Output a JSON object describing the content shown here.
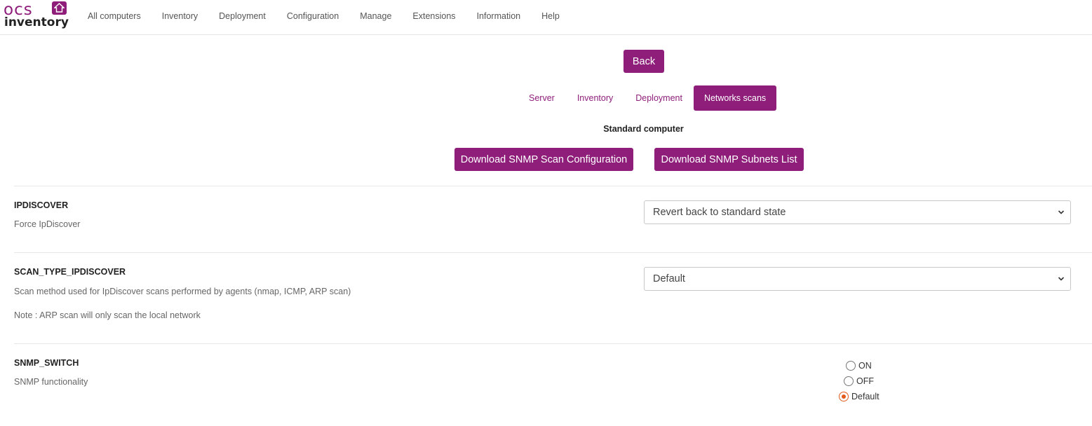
{
  "brand": {
    "logo_top": "ocs",
    "logo_bottom": "inventory",
    "color": "#8e1e7a"
  },
  "nav": {
    "items": [
      "All computers",
      "Inventory",
      "Deployment",
      "Configuration",
      "Manage",
      "Extensions",
      "Information",
      "Help"
    ]
  },
  "back_label": "Back",
  "tabs": [
    {
      "label": "Server",
      "active": false
    },
    {
      "label": "Inventory",
      "active": false
    },
    {
      "label": "Deployment",
      "active": false
    },
    {
      "label": "Networks scans",
      "active": true
    }
  ],
  "subtitle": "Standard computer",
  "downloads": {
    "scan_config": "Download SNMP Scan Configuration",
    "subnets_list": "Download SNMP Subnets List"
  },
  "options": {
    "ipdiscover": {
      "name": "IPDISCOVER",
      "desc": "Force IpDiscover",
      "selected": "Revert back to standard state"
    },
    "scan_type": {
      "name": "SCAN_TYPE_IPDISCOVER",
      "desc": "Scan method used for IpDiscover scans performed by agents (nmap, ICMP, ARP scan)",
      "note": "Note : ARP scan will only scan the local network",
      "selected": "Default"
    },
    "snmp_switch": {
      "name": "SNMP_SWITCH",
      "desc": "SNMP functionality",
      "choices": [
        "ON",
        "OFF",
        "Default"
      ],
      "selected": "Default"
    }
  },
  "colors": {
    "accent": "#8e1e7a",
    "radio_checked": "#e35b1c"
  }
}
